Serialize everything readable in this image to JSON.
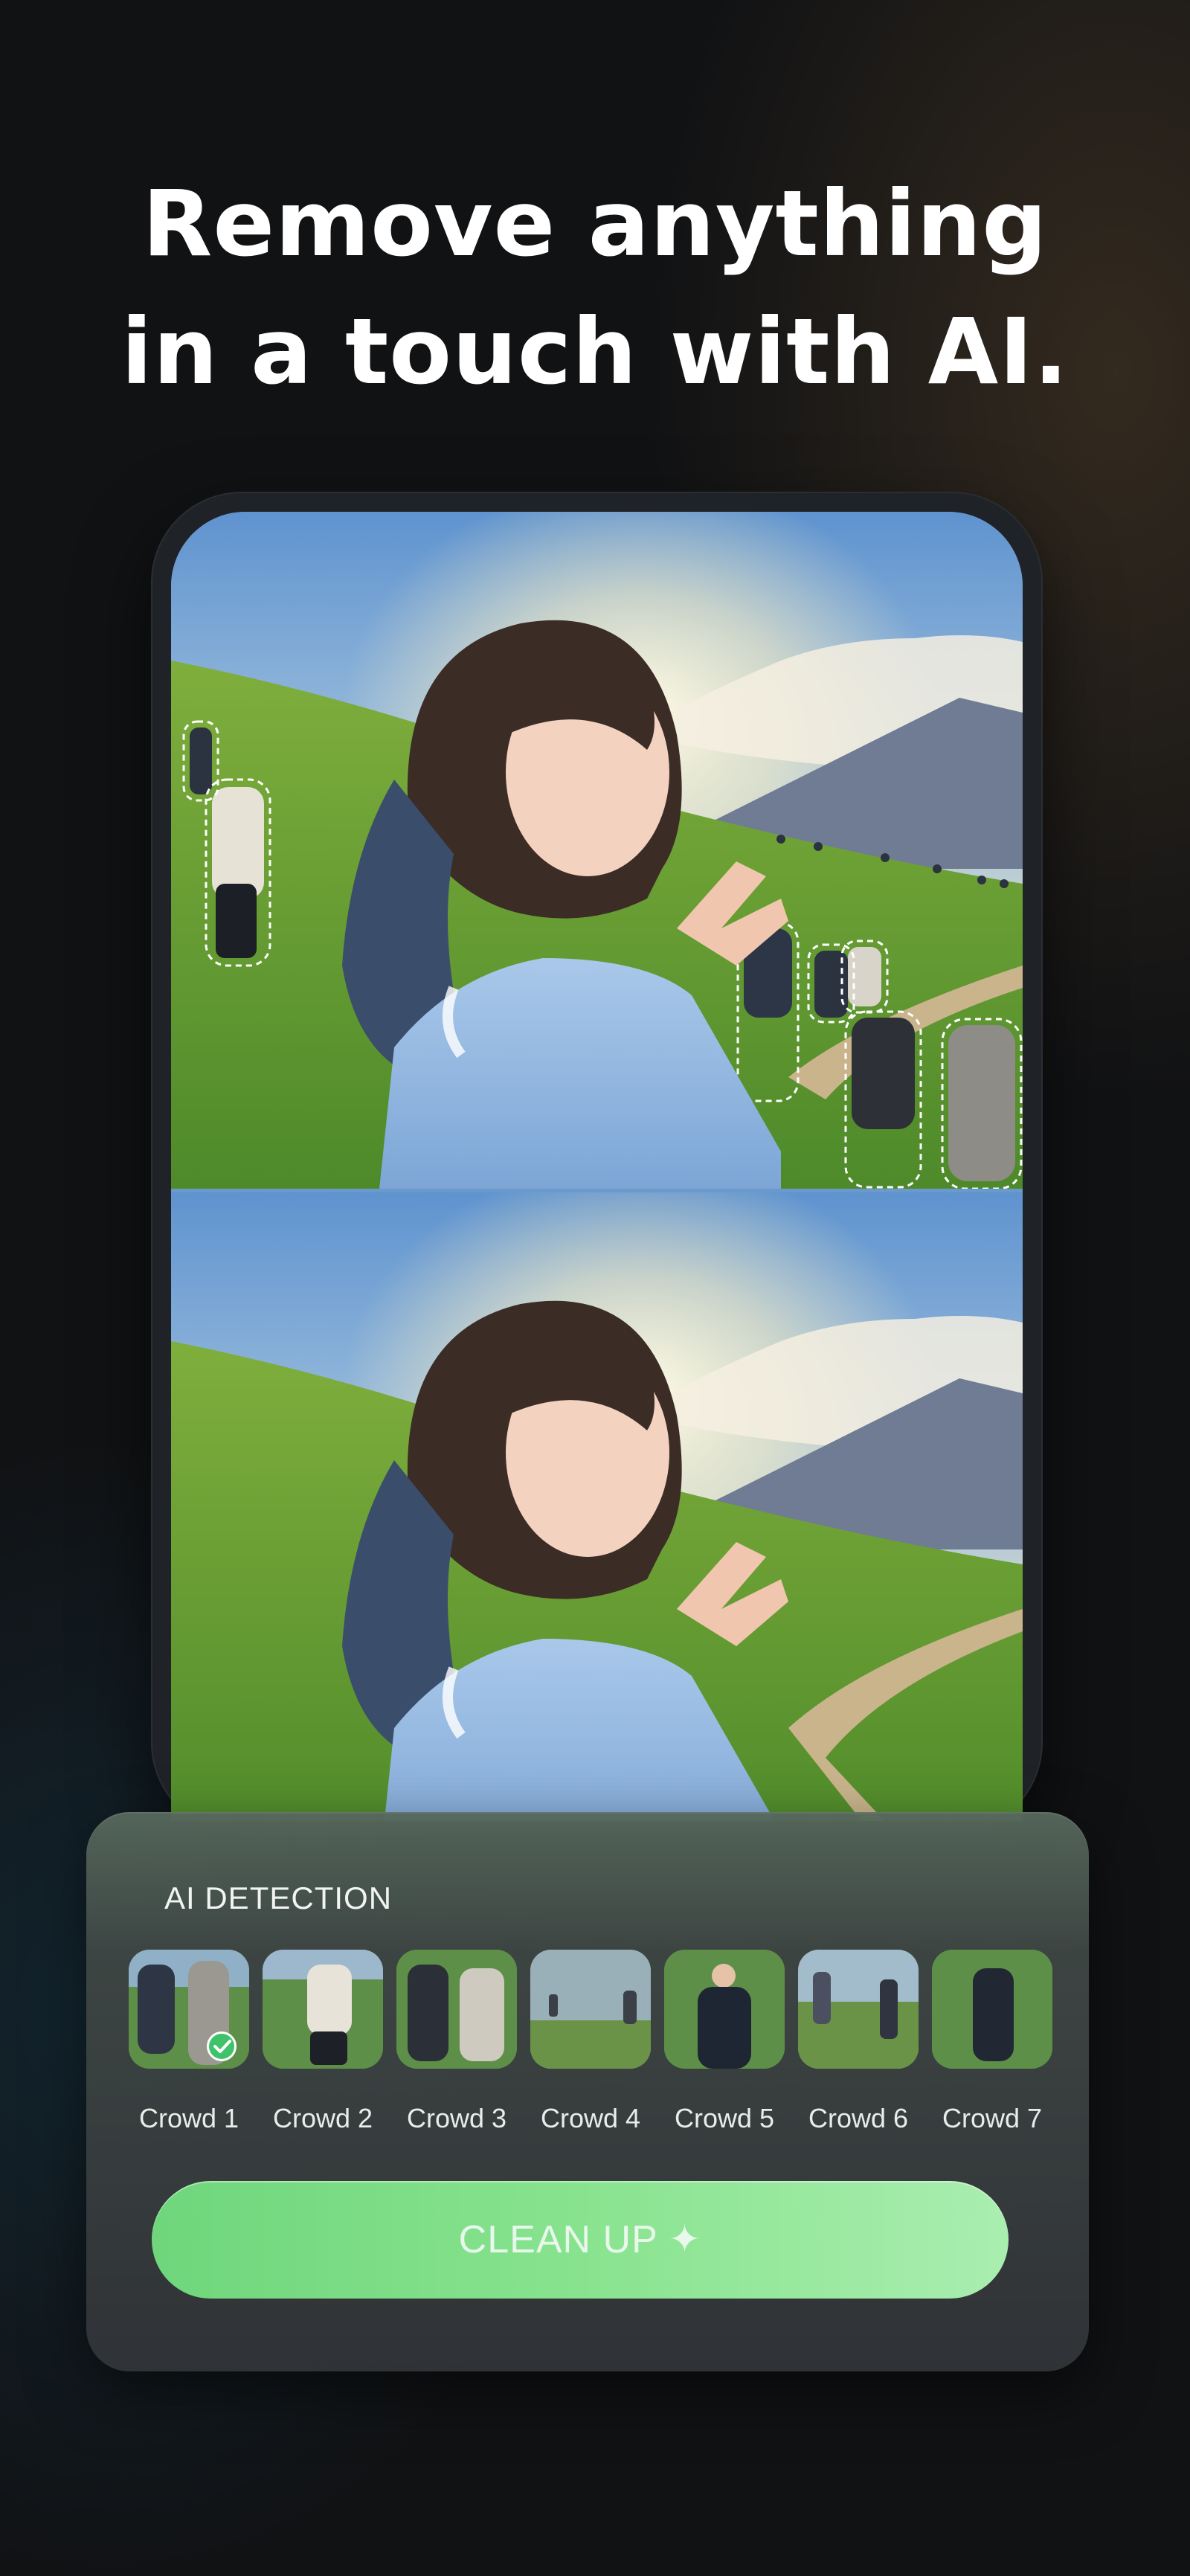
{
  "headline": {
    "line1": "Remove anything",
    "line2": "in a touch with AI."
  },
  "phone_preview": {
    "before_image": "photo-with-crowd-outlined",
    "after_image": "photo-crowd-removed"
  },
  "detection_panel": {
    "title": "AI DETECTION",
    "selected_index": 0,
    "items": [
      {
        "label": "Crowd 1",
        "selected": true
      },
      {
        "label": "Crowd 2",
        "selected": false
      },
      {
        "label": "Crowd 3",
        "selected": false
      },
      {
        "label": "Crowd 4",
        "selected": false
      },
      {
        "label": "Crowd 5",
        "selected": false
      },
      {
        "label": "Crowd 6",
        "selected": false
      },
      {
        "label": "Crowd 7",
        "selected": false
      }
    ],
    "cleanup_button": {
      "label": "CLEAN UP",
      "icon": "sparkle-icon",
      "icon_glyph": "✦"
    }
  },
  "colors": {
    "background": "#111214",
    "accent_green": "#88e38e",
    "check_green": "#3fc36a"
  }
}
